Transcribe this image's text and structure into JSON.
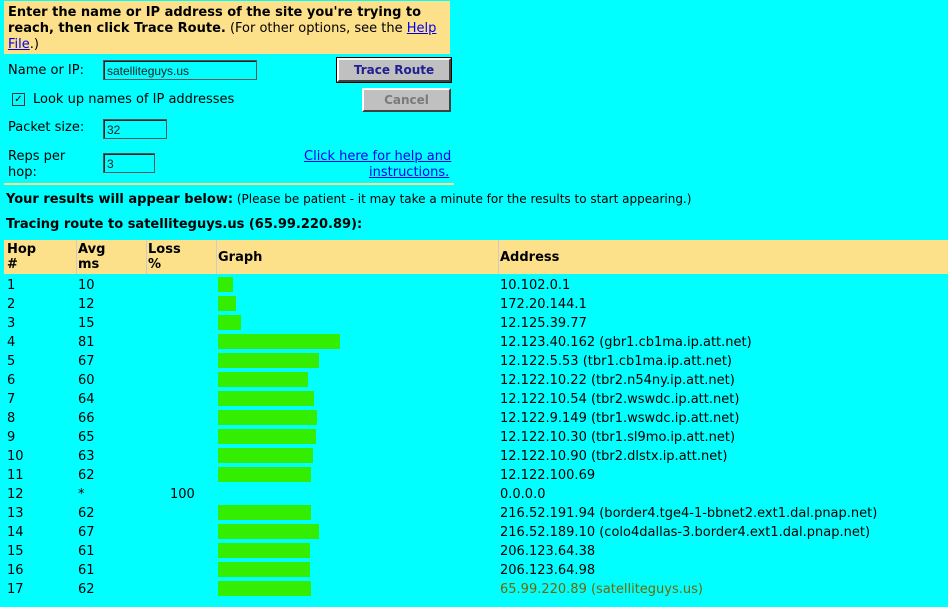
{
  "instructions": {
    "bold_text": "Enter the name or IP address of the site you're trying to reach, then click Trace Route.",
    "normal_text": " (For other options, see the ",
    "link_text": "Help File",
    "close_text": ".)"
  },
  "form": {
    "name_label": "Name or IP:",
    "name_value": "satelliteguys.us",
    "trace_button": "Trace Route",
    "lookup_label": "Look up names of IP addresses",
    "lookup_checked": "✓",
    "cancel_button": "Cancel",
    "packet_label": "Packet size:",
    "packet_value": "32",
    "reps_label_1": "Reps per",
    "reps_label_2": "hop:",
    "reps_value": "3",
    "help_link_1": "Click here for help and",
    "help_link_2": "instructions."
  },
  "results": {
    "heading": "Your results will appear below:",
    "note": " (Please be patient - it may take a minute for the results to start appearing.)",
    "tracing": "Tracing route to satelliteguys.us (65.99.220.89):"
  },
  "table": {
    "headers": {
      "hop_1": "Hop",
      "hop_2": "#",
      "avg_1": "Avg",
      "avg_2": "ms",
      "loss_1": "Loss",
      "loss_2": "%",
      "graph": "Graph",
      "address": "Address"
    },
    "rows": [
      {
        "hop": "1",
        "avg": "10",
        "loss": "",
        "ms": 10,
        "address": "10.102.0.1"
      },
      {
        "hop": "2",
        "avg": "12",
        "loss": "",
        "ms": 12,
        "address": "172.20.144.1"
      },
      {
        "hop": "3",
        "avg": "15",
        "loss": "",
        "ms": 15,
        "address": "12.125.39.77"
      },
      {
        "hop": "4",
        "avg": "81",
        "loss": "",
        "ms": 81,
        "address": "12.123.40.162 (gbr1.cb1ma.ip.att.net)"
      },
      {
        "hop": "5",
        "avg": "67",
        "loss": "",
        "ms": 67,
        "address": "12.122.5.53 (tbr1.cb1ma.ip.att.net)"
      },
      {
        "hop": "6",
        "avg": "60",
        "loss": "",
        "ms": 60,
        "address": "12.122.10.22 (tbr2.n54ny.ip.att.net)"
      },
      {
        "hop": "7",
        "avg": "64",
        "loss": "",
        "ms": 64,
        "address": "12.122.10.54 (tbr2.wswdc.ip.att.net)"
      },
      {
        "hop": "8",
        "avg": "66",
        "loss": "",
        "ms": 66,
        "address": "12.122.9.149 (tbr1.wswdc.ip.att.net)"
      },
      {
        "hop": "9",
        "avg": "65",
        "loss": "",
        "ms": 65,
        "address": "12.122.10.30 (tbr1.sl9mo.ip.att.net)"
      },
      {
        "hop": "10",
        "avg": "63",
        "loss": "",
        "ms": 63,
        "address": "12.122.10.90 (tbr2.dlstx.ip.att.net)"
      },
      {
        "hop": "11",
        "avg": "62",
        "loss": "",
        "ms": 62,
        "address": "12.122.100.69"
      },
      {
        "hop": "12",
        "avg": "*",
        "loss": "100",
        "ms": 0,
        "address": "0.0.0.0"
      },
      {
        "hop": "13",
        "avg": "62",
        "loss": "",
        "ms": 62,
        "address": "216.52.191.94 (border4.tge4-1-bbnet2.ext1.dal.pnap.net)"
      },
      {
        "hop": "14",
        "avg": "67",
        "loss": "",
        "ms": 67,
        "address": "216.52.189.10 (colo4dallas-3.border4.ext1.dal.pnap.net)"
      },
      {
        "hop": "15",
        "avg": "61",
        "loss": "",
        "ms": 61,
        "address": "206.123.64.38"
      },
      {
        "hop": "16",
        "avg": "61",
        "loss": "",
        "ms": 61,
        "address": "206.123.64.98"
      },
      {
        "hop": "17",
        "avg": "62",
        "loss": "",
        "ms": 62,
        "address": "65.99.220.89 (satelliteguys.us)",
        "final": true
      }
    ]
  },
  "colors": {
    "background": "#00ffff",
    "panel": "#fde08a",
    "bar": "#33ee00",
    "final_address": "#776600"
  }
}
